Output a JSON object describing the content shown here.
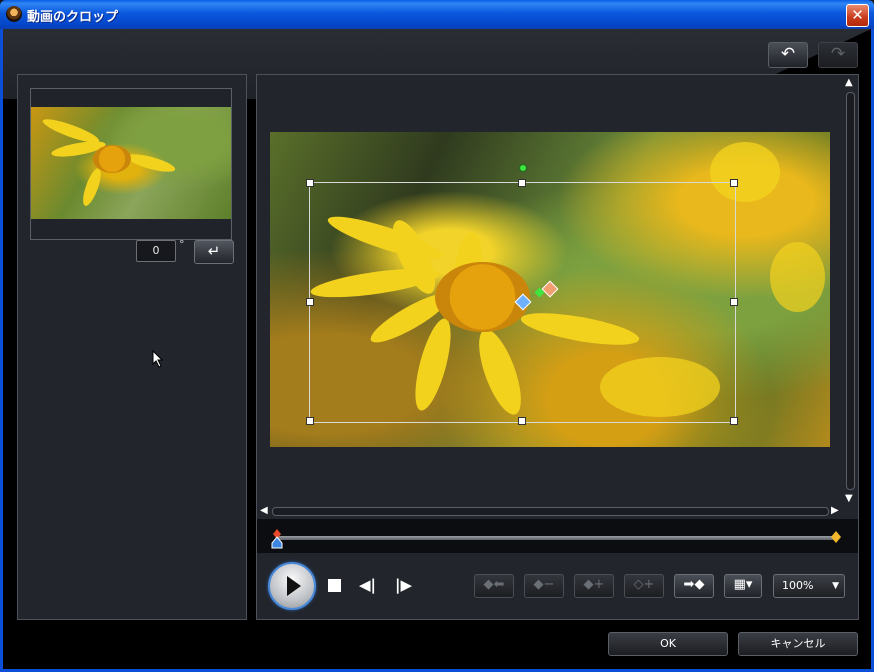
{
  "window": {
    "title": "動画のクロップ",
    "close_glyph": "✕"
  },
  "toolbar": {
    "undo_icon": "undo-arrow",
    "redo_icon": "redo-arrow",
    "undo_glyph": "↶",
    "redo_glyph": "↷"
  },
  "rotation": {
    "value": "0",
    "unit": "°",
    "apply_glyph": "↵"
  },
  "controls": {
    "prev_frame_glyph": "◀|",
    "next_frame_glyph": "|▶",
    "keyframe_buttons": [
      {
        "name": "go-previous-keyframe",
        "glyph": "◆⬅",
        "enabled": false
      },
      {
        "name": "remove-keyframe",
        "glyph": "◆−",
        "enabled": false
      },
      {
        "name": "add-keyframe",
        "glyph": "◆+",
        "enabled": false
      },
      {
        "name": "duplicate-keyframe",
        "glyph": "◇+",
        "enabled": false
      },
      {
        "name": "go-next-keyframe",
        "glyph": "➡◆",
        "enabled": true
      }
    ],
    "aspect_glyph": "▦▾",
    "zoom": "100%"
  },
  "timeline": {
    "position": 0.0,
    "start_color": "#e8492b",
    "end_color": "#f2b92c"
  },
  "buttons": {
    "ok": "OK",
    "cancel": "キャンセル"
  },
  "colors": {
    "accent": "#4a89d8",
    "title_bar": "#0b58de"
  }
}
